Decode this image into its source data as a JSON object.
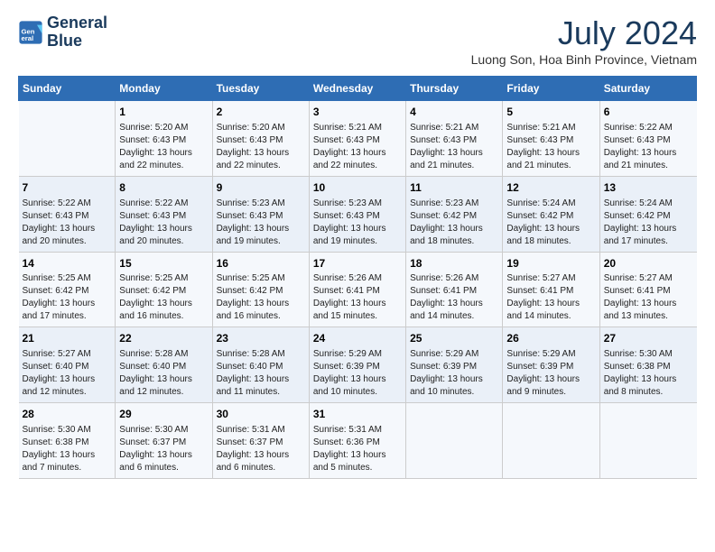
{
  "header": {
    "logo_line1": "General",
    "logo_line2": "Blue",
    "month_year": "July 2024",
    "location": "Luong Son, Hoa Binh Province, Vietnam"
  },
  "days_of_week": [
    "Sunday",
    "Monday",
    "Tuesday",
    "Wednesday",
    "Thursday",
    "Friday",
    "Saturday"
  ],
  "weeks": [
    [
      {
        "day": "",
        "detail": ""
      },
      {
        "day": "1",
        "detail": "Sunrise: 5:20 AM\nSunset: 6:43 PM\nDaylight: 13 hours\nand 22 minutes."
      },
      {
        "day": "2",
        "detail": "Sunrise: 5:20 AM\nSunset: 6:43 PM\nDaylight: 13 hours\nand 22 minutes."
      },
      {
        "day": "3",
        "detail": "Sunrise: 5:21 AM\nSunset: 6:43 PM\nDaylight: 13 hours\nand 22 minutes."
      },
      {
        "day": "4",
        "detail": "Sunrise: 5:21 AM\nSunset: 6:43 PM\nDaylight: 13 hours\nand 21 minutes."
      },
      {
        "day": "5",
        "detail": "Sunrise: 5:21 AM\nSunset: 6:43 PM\nDaylight: 13 hours\nand 21 minutes."
      },
      {
        "day": "6",
        "detail": "Sunrise: 5:22 AM\nSunset: 6:43 PM\nDaylight: 13 hours\nand 21 minutes."
      }
    ],
    [
      {
        "day": "7",
        "detail": "Sunrise: 5:22 AM\nSunset: 6:43 PM\nDaylight: 13 hours\nand 20 minutes."
      },
      {
        "day": "8",
        "detail": "Sunrise: 5:22 AM\nSunset: 6:43 PM\nDaylight: 13 hours\nand 20 minutes."
      },
      {
        "day": "9",
        "detail": "Sunrise: 5:23 AM\nSunset: 6:43 PM\nDaylight: 13 hours\nand 19 minutes."
      },
      {
        "day": "10",
        "detail": "Sunrise: 5:23 AM\nSunset: 6:43 PM\nDaylight: 13 hours\nand 19 minutes."
      },
      {
        "day": "11",
        "detail": "Sunrise: 5:23 AM\nSunset: 6:42 PM\nDaylight: 13 hours\nand 18 minutes."
      },
      {
        "day": "12",
        "detail": "Sunrise: 5:24 AM\nSunset: 6:42 PM\nDaylight: 13 hours\nand 18 minutes."
      },
      {
        "day": "13",
        "detail": "Sunrise: 5:24 AM\nSunset: 6:42 PM\nDaylight: 13 hours\nand 17 minutes."
      }
    ],
    [
      {
        "day": "14",
        "detail": "Sunrise: 5:25 AM\nSunset: 6:42 PM\nDaylight: 13 hours\nand 17 minutes."
      },
      {
        "day": "15",
        "detail": "Sunrise: 5:25 AM\nSunset: 6:42 PM\nDaylight: 13 hours\nand 16 minutes."
      },
      {
        "day": "16",
        "detail": "Sunrise: 5:25 AM\nSunset: 6:42 PM\nDaylight: 13 hours\nand 16 minutes."
      },
      {
        "day": "17",
        "detail": "Sunrise: 5:26 AM\nSunset: 6:41 PM\nDaylight: 13 hours\nand 15 minutes."
      },
      {
        "day": "18",
        "detail": "Sunrise: 5:26 AM\nSunset: 6:41 PM\nDaylight: 13 hours\nand 14 minutes."
      },
      {
        "day": "19",
        "detail": "Sunrise: 5:27 AM\nSunset: 6:41 PM\nDaylight: 13 hours\nand 14 minutes."
      },
      {
        "day": "20",
        "detail": "Sunrise: 5:27 AM\nSunset: 6:41 PM\nDaylight: 13 hours\nand 13 minutes."
      }
    ],
    [
      {
        "day": "21",
        "detail": "Sunrise: 5:27 AM\nSunset: 6:40 PM\nDaylight: 13 hours\nand 12 minutes."
      },
      {
        "day": "22",
        "detail": "Sunrise: 5:28 AM\nSunset: 6:40 PM\nDaylight: 13 hours\nand 12 minutes."
      },
      {
        "day": "23",
        "detail": "Sunrise: 5:28 AM\nSunset: 6:40 PM\nDaylight: 13 hours\nand 11 minutes."
      },
      {
        "day": "24",
        "detail": "Sunrise: 5:29 AM\nSunset: 6:39 PM\nDaylight: 13 hours\nand 10 minutes."
      },
      {
        "day": "25",
        "detail": "Sunrise: 5:29 AM\nSunset: 6:39 PM\nDaylight: 13 hours\nand 10 minutes."
      },
      {
        "day": "26",
        "detail": "Sunrise: 5:29 AM\nSunset: 6:39 PM\nDaylight: 13 hours\nand 9 minutes."
      },
      {
        "day": "27",
        "detail": "Sunrise: 5:30 AM\nSunset: 6:38 PM\nDaylight: 13 hours\nand 8 minutes."
      }
    ],
    [
      {
        "day": "28",
        "detail": "Sunrise: 5:30 AM\nSunset: 6:38 PM\nDaylight: 13 hours\nand 7 minutes."
      },
      {
        "day": "29",
        "detail": "Sunrise: 5:30 AM\nSunset: 6:37 PM\nDaylight: 13 hours\nand 6 minutes."
      },
      {
        "day": "30",
        "detail": "Sunrise: 5:31 AM\nSunset: 6:37 PM\nDaylight: 13 hours\nand 6 minutes."
      },
      {
        "day": "31",
        "detail": "Sunrise: 5:31 AM\nSunset: 6:36 PM\nDaylight: 13 hours\nand 5 minutes."
      },
      {
        "day": "",
        "detail": ""
      },
      {
        "day": "",
        "detail": ""
      },
      {
        "day": "",
        "detail": ""
      }
    ]
  ]
}
